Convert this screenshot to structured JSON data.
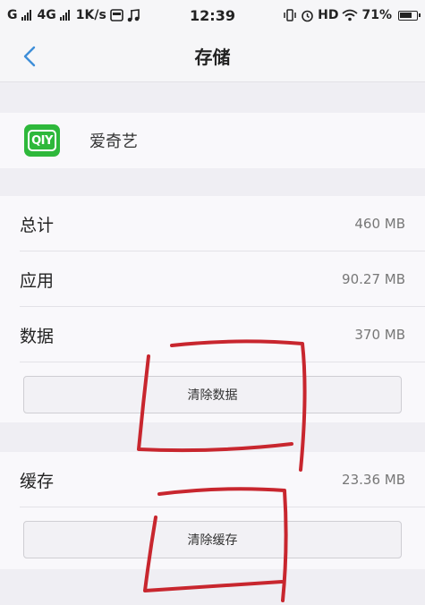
{
  "status_bar": {
    "carrier1": "G",
    "carrier2": "4G",
    "speed": "1K/s",
    "time": "12:39",
    "hd": "HD",
    "battery": "71%"
  },
  "nav": {
    "title": "存储"
  },
  "app": {
    "name": "爱奇艺",
    "logo_text": "QIY",
    "logo_color": "#2eb83b"
  },
  "storage": {
    "rows": [
      {
        "label": "总计",
        "value": "460 MB"
      },
      {
        "label": "应用",
        "value": "90.27 MB"
      },
      {
        "label": "数据",
        "value": "370 MB"
      }
    ],
    "clear_data_label": "清除数据"
  },
  "cache": {
    "label": "缓存",
    "value": "23.36 MB",
    "clear_cache_label": "清除缓存"
  },
  "colors": {
    "accent": "#3e8ed8",
    "annotation": "#c8262e"
  }
}
